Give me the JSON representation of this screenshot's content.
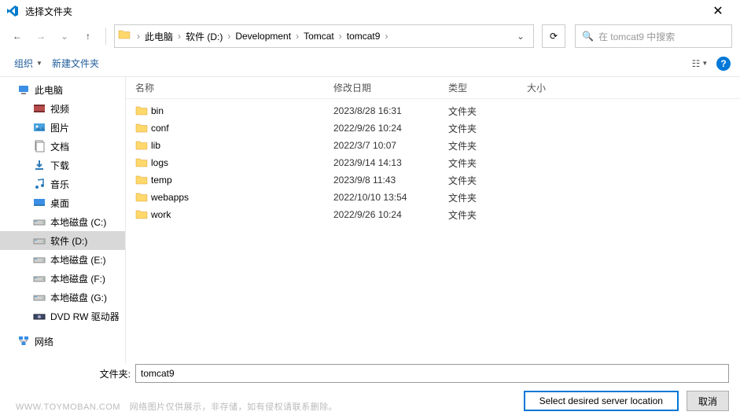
{
  "title": "选择文件夹",
  "close_glyph": "✕",
  "nav": {
    "back_glyph": "←",
    "forward_glyph": "→",
    "recent_glyph": "⌄",
    "up_glyph": "↑",
    "refresh_glyph": "⟳",
    "dropdown_glyph": "⌄"
  },
  "breadcrumb": {
    "items": [
      "此电脑",
      "软件 (D:)",
      "Development",
      "Tomcat",
      "tomcat9"
    ],
    "chevron": "›"
  },
  "search": {
    "placeholder": "在 tomcat9 中搜索",
    "icon_glyph": "🔍"
  },
  "toolbar": {
    "organize": "组织",
    "new_folder": "新建文件夹",
    "view_glyph": "☷",
    "help_glyph": "?"
  },
  "sidebar": {
    "items": [
      {
        "label": "此电脑",
        "icon": "pc",
        "level": 0,
        "selected": false
      },
      {
        "label": "视频",
        "icon": "video",
        "level": 1,
        "selected": false
      },
      {
        "label": "图片",
        "icon": "pictures",
        "level": 1,
        "selected": false
      },
      {
        "label": "文档",
        "icon": "documents",
        "level": 1,
        "selected": false
      },
      {
        "label": "下载",
        "icon": "downloads",
        "level": 1,
        "selected": false
      },
      {
        "label": "音乐",
        "icon": "music",
        "level": 1,
        "selected": false
      },
      {
        "label": "桌面",
        "icon": "desktop",
        "level": 1,
        "selected": false
      },
      {
        "label": "本地磁盘 (C:)",
        "icon": "drive",
        "level": 1,
        "selected": false
      },
      {
        "label": "软件 (D:)",
        "icon": "drive",
        "level": 1,
        "selected": true
      },
      {
        "label": "本地磁盘 (E:)",
        "icon": "drive",
        "level": 1,
        "selected": false
      },
      {
        "label": "本地磁盘 (F:)",
        "icon": "drive",
        "level": 1,
        "selected": false
      },
      {
        "label": "本地磁盘 (G:)",
        "icon": "drive",
        "level": 1,
        "selected": false
      },
      {
        "label": "DVD RW 驱动器",
        "icon": "dvd",
        "level": 1,
        "selected": false
      }
    ],
    "network_label": "网络",
    "network_icon": "network"
  },
  "columns": {
    "name": "名称",
    "date": "修改日期",
    "type": "类型",
    "size": "大小"
  },
  "files": [
    {
      "name": "bin",
      "date": "2023/8/28 16:31",
      "type": "文件夹"
    },
    {
      "name": "conf",
      "date": "2022/9/26 10:24",
      "type": "文件夹"
    },
    {
      "name": "lib",
      "date": "2022/3/7 10:07",
      "type": "文件夹"
    },
    {
      "name": "logs",
      "date": "2023/9/14 14:13",
      "type": "文件夹"
    },
    {
      "name": "temp",
      "date": "2023/9/8 11:43",
      "type": "文件夹"
    },
    {
      "name": "webapps",
      "date": "2022/10/10 13:54",
      "type": "文件夹"
    },
    {
      "name": "work",
      "date": "2022/9/26 10:24",
      "type": "文件夹"
    }
  ],
  "bottom": {
    "folder_label": "文件夹:",
    "folder_value": "tomcat9",
    "select_button": "Select desired server location",
    "cancel_button": "取消"
  },
  "watermark": {
    "site": "WWW.TOYMOBAN.COM",
    "note": "网络图片仅供展示，非存储，如有侵权请联系删除。"
  }
}
